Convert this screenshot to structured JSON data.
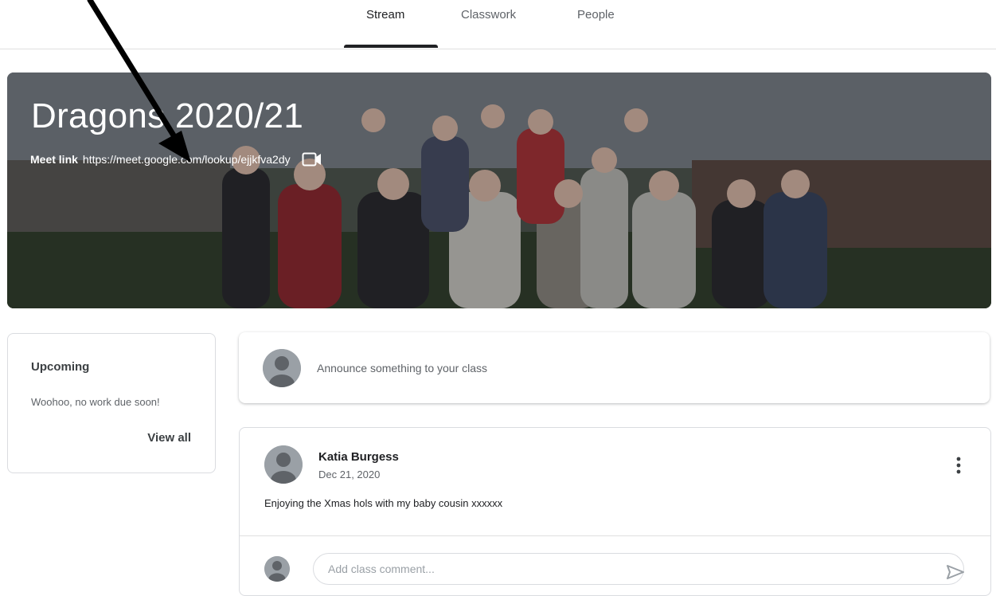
{
  "tabs": [
    {
      "label": "Stream",
      "active": true
    },
    {
      "label": "Classwork",
      "active": false
    },
    {
      "label": "People",
      "active": false
    }
  ],
  "banner": {
    "title": "Dragons 2020/21",
    "meet_label": "Meet link",
    "meet_url": "https://meet.google.com/lookup/ejjkfva2dy",
    "video_icon": "video-camera-icon"
  },
  "upcoming": {
    "title": "Upcoming",
    "message": "Woohoo, no work due soon!",
    "view_all": "View all"
  },
  "announce": {
    "placeholder": "Announce something to your class"
  },
  "post": {
    "author": "Katia Burgess",
    "date": "Dec 21, 2020",
    "body": "Enjoying the Xmas hols with my baby cousin xxxxxx",
    "comment_placeholder": "Add class comment..."
  },
  "colors": {
    "accent": "#202124",
    "muted": "#5f6368",
    "border": "#dadce0",
    "avatar": "#9aa0a6"
  }
}
